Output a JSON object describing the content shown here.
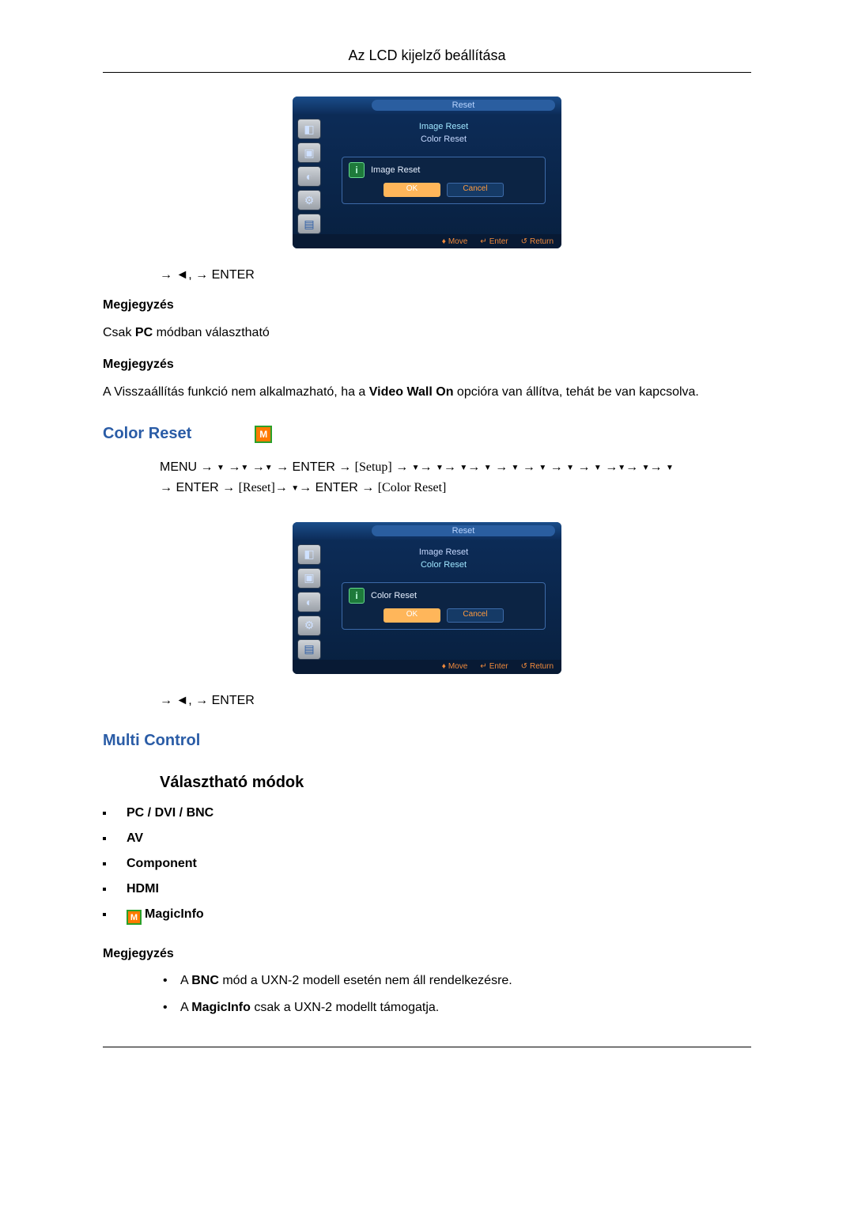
{
  "header": {
    "title": "Az LCD kijelző beállítása"
  },
  "osd1": {
    "title": "Reset",
    "items": [
      "Image Reset",
      "Color Reset"
    ],
    "dialog": {
      "title": "Image Reset",
      "ok": "OK",
      "cancel": "Cancel"
    },
    "footer": {
      "move": "Move",
      "enter": "Enter",
      "return": "Return"
    }
  },
  "osd2": {
    "title": "Reset",
    "items": [
      "Image Reset",
      "Color Reset"
    ],
    "dialog": {
      "title": "Color Reset",
      "ok": "OK",
      "cancel": "Cancel"
    },
    "footer": {
      "move": "Move",
      "enter": "Enter",
      "return": "Return"
    }
  },
  "enter_line": "→ ◄,   → ENTER",
  "note_label": "Megjegyzés",
  "para_pc_only_pre": "Csak ",
  "para_pc_only_bold": "PC",
  "para_pc_only_post": " módban választható",
  "para_reset_pre": "A Visszaállítás funkció nem alkalmazható, ha a ",
  "para_reset_bold": "Video Wall On",
  "para_reset_post": " opcióra van állítva, tehát be van kapcsolva.",
  "h_color_reset": "Color Reset",
  "seq2_line1_a": "MENU → ",
  "seq2_line1_b": " → ENTER → ",
  "seq2_setup": "[Setup]",
  "seq2_line2_a": "→ ENTER → ",
  "seq2_reset": "[Reset]",
  "seq2_line2_b": "→ ENTER → ",
  "seq2_colorreset": "[Color Reset]",
  "h_multi_control": "Multi Control",
  "h_modes": "Választható módok",
  "modes": {
    "m1": "PC / DVI / BNC",
    "m2": "AV",
    "m3": "Component",
    "m4": "HDMI",
    "m5": "MagicInfo"
  },
  "note2_b1_pre": "A ",
  "note2_b1_bold": "BNC",
  "note2_b1_post": " mód a UXN-2 modell esetén nem áll rendelkezésre.",
  "note2_b2_pre": "A ",
  "note2_b2_bold": "MagicInfo",
  "note2_b2_post": " csak a UXN-2 modellt támogatja."
}
